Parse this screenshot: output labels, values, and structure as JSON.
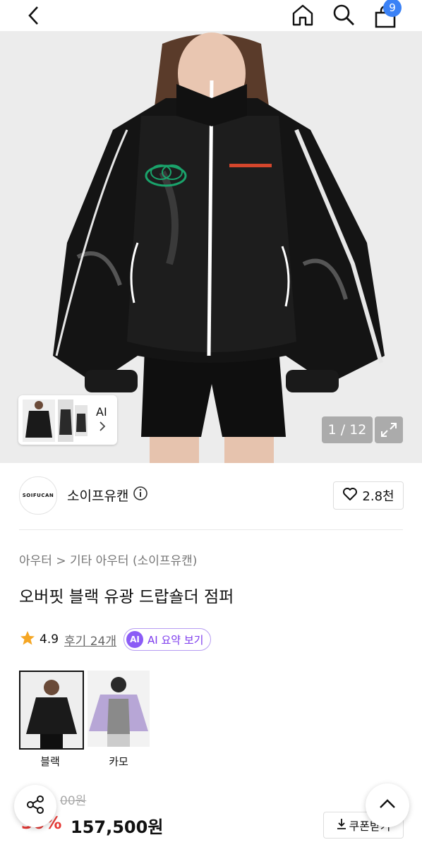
{
  "header": {
    "cart_count": "9"
  },
  "gallery": {
    "thumb_label": "AI",
    "counter": "1 / 12"
  },
  "brand": {
    "logo_text": "SOIFUCAN",
    "name": "소이프유캔",
    "likes": "2.8천"
  },
  "product": {
    "breadcrumb": "아우터 > 기타 아우터 (소이프유캔)",
    "title": "오버핏 블랙 유광 드랍숄더 점퍼",
    "rating": "4.9",
    "reviews": "후기 24개",
    "ai_chip_icon": "AI",
    "ai_chip_label": "AI 요약 보기"
  },
  "colors": [
    {
      "label": "블랙",
      "selected": true,
      "color": "#1a1a1a"
    },
    {
      "label": "카모",
      "selected": false,
      "color": "#b7a6d6"
    }
  ],
  "pricing": {
    "original": "00원",
    "discount": "30%",
    "price": "157,500원",
    "coupon": "쿠폰받기"
  },
  "icons": [
    "back-icon",
    "home-icon",
    "search-icon",
    "cart-icon",
    "expand-icon",
    "heart-icon",
    "info-icon",
    "star-icon",
    "share-icon",
    "chevron-up-icon",
    "download-icon"
  ]
}
